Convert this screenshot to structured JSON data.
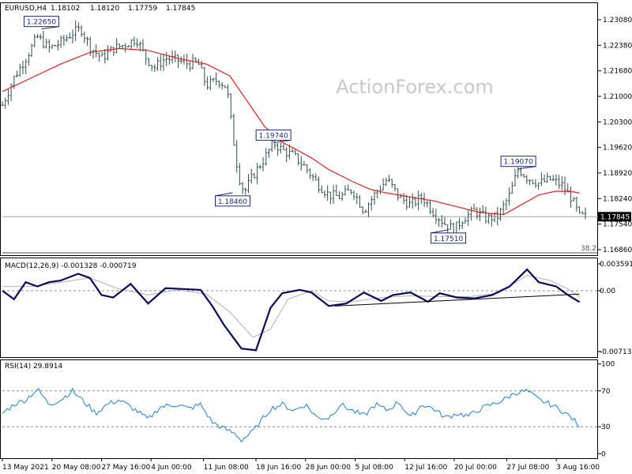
{
  "header": {
    "symbol": "EURUSD,H4",
    "ohlc": [
      "1.18102",
      "1.18120",
      "1.17759",
      "1.17845"
    ]
  },
  "watermark": "ActionForex.com",
  "colors": {
    "candle": "#2f4f4f",
    "ma": "#e02020",
    "macd": "#0a0a5a",
    "signal": "#b0b0b0",
    "rsi": "#1e7fd0",
    "price_line": "#a0a0a0",
    "trend": "#000000"
  },
  "chart_data": [
    {
      "type": "candlestick",
      "name": "price",
      "title": "EURUSD,H4 1.18102 1.18120 1.17759 1.17845",
      "ylim": [
        1.1686,
        1.2333
      ],
      "yticks": [
        "1.23080",
        "1.22380",
        "1.21680",
        "1.21000",
        "1.20300",
        "1.19620",
        "1.18920",
        "1.18240",
        "1.17540",
        "1.16860"
      ],
      "current_price": "1.17845",
      "fib_label": "38.2",
      "fib_level": 1.1692,
      "annotations": [
        {
          "label": "1.22650",
          "t": 0.067,
          "value": 1.2265
        },
        {
          "label": "1.18460",
          "t": 0.395,
          "value": 1.1846
        },
        {
          "label": "1.19740",
          "t": 0.465,
          "value": 1.1974
        },
        {
          "label": "1.17510",
          "t": 0.765,
          "value": 1.1751
        },
        {
          "label": "1.19070",
          "t": 0.885,
          "value": 1.1907
        }
      ],
      "path_points": [
        [
          0,
          1.207
        ],
        [
          0.02,
          1.214
        ],
        [
          0.04,
          1.219
        ],
        [
          0.06,
          1.2245
        ],
        [
          0.08,
          1.2215
        ],
        [
          0.1,
          1.223
        ],
        [
          0.12,
          1.2255
        ],
        [
          0.135,
          1.2265
        ],
        [
          0.15,
          1.222
        ],
        [
          0.17,
          1.219
        ],
        [
          0.19,
          1.2215
        ],
        [
          0.21,
          1.2225
        ],
        [
          0.23,
          1.224
        ],
        [
          0.245,
          1.2195
        ],
        [
          0.26,
          1.2165
        ],
        [
          0.28,
          1.219
        ],
        [
          0.3,
          1.2185
        ],
        [
          0.32,
          1.2175
        ],
        [
          0.335,
          1.218
        ],
        [
          0.35,
          1.212
        ],
        [
          0.37,
          1.2135
        ],
        [
          0.385,
          1.2115
        ],
        [
          0.395,
          1.1995
        ],
        [
          0.405,
          1.189
        ],
        [
          0.415,
          1.1846
        ],
        [
          0.43,
          1.189
        ],
        [
          0.45,
          1.1935
        ],
        [
          0.465,
          1.1974
        ],
        [
          0.48,
          1.1955
        ],
        [
          0.5,
          1.194
        ],
        [
          0.52,
          1.191
        ],
        [
          0.54,
          1.187
        ],
        [
          0.56,
          1.184
        ],
        [
          0.58,
          1.1835
        ],
        [
          0.6,
          1.1855
        ],
        [
          0.62,
          1.18
        ],
        [
          0.64,
          1.1845
        ],
        [
          0.66,
          1.188
        ],
        [
          0.68,
          1.1835
        ],
        [
          0.7,
          1.1815
        ],
        [
          0.72,
          1.1835
        ],
        [
          0.74,
          1.1795
        ],
        [
          0.76,
          1.1765
        ],
        [
          0.775,
          1.1751
        ],
        [
          0.79,
          1.178
        ],
        [
          0.81,
          1.18
        ],
        [
          0.83,
          1.178
        ],
        [
          0.85,
          1.1785
        ],
        [
          0.87,
          1.184
        ],
        [
          0.885,
          1.1907
        ],
        [
          0.9,
          1.1885
        ],
        [
          0.92,
          1.187
        ],
        [
          0.94,
          1.188
        ],
        [
          0.96,
          1.1865
        ],
        [
          0.975,
          1.1835
        ],
        [
          0.99,
          1.1785
        ]
      ],
      "ma_points": [
        [
          0,
          1.2105
        ],
        [
          0.05,
          1.214
        ],
        [
          0.1,
          1.2175
        ],
        [
          0.15,
          1.2205
        ],
        [
          0.2,
          1.2215
        ],
        [
          0.25,
          1.221
        ],
        [
          0.3,
          1.219
        ],
        [
          0.35,
          1.2175
        ],
        [
          0.39,
          1.2145
        ],
        [
          0.42,
          1.208
        ],
        [
          0.45,
          1.2015
        ],
        [
          0.48,
          1.1975
        ],
        [
          0.5,
          1.196
        ],
        [
          0.53,
          1.1935
        ],
        [
          0.56,
          1.1905
        ],
        [
          0.6,
          1.1875
        ],
        [
          0.63,
          1.1855
        ],
        [
          0.66,
          1.1845
        ],
        [
          0.7,
          1.1835
        ],
        [
          0.74,
          1.1825
        ],
        [
          0.78,
          1.181
        ],
        [
          0.82,
          1.1795
        ],
        [
          0.86,
          1.179
        ],
        [
          0.89,
          1.1815
        ],
        [
          0.92,
          1.184
        ],
        [
          0.95,
          1.185
        ],
        [
          0.98,
          1.1848
        ],
        [
          0.99,
          1.1845
        ]
      ]
    },
    {
      "type": "line",
      "name": "macd",
      "title": "MACD(12,26,9) -0.001328 -0.000719",
      "ylim": [
        -0.0078,
        0.0039
      ],
      "yticks": [
        {
          "label": "0.003591",
          "value": 0.003591
        },
        {
          "label": "0.00",
          "value": 0
        },
        {
          "label": "-0.007137",
          "value": -0.007137
        }
      ],
      "macd_points": [
        [
          0,
          0
        ],
        [
          0.02,
          -0.001
        ],
        [
          0.04,
          0.001
        ],
        [
          0.06,
          0.0005
        ],
        [
          0.08,
          0.001
        ],
        [
          0.1,
          0.0012
        ],
        [
          0.13,
          0.002
        ],
        [
          0.15,
          0.0015
        ],
        [
          0.17,
          -0.0005
        ],
        [
          0.19,
          -0.0008
        ],
        [
          0.22,
          0.0008
        ],
        [
          0.25,
          -0.0015
        ],
        [
          0.28,
          0.0003
        ],
        [
          0.31,
          0.0002
        ],
        [
          0.34,
          0.0001
        ],
        [
          0.36,
          -0.0018
        ],
        [
          0.38,
          -0.004
        ],
        [
          0.41,
          -0.0068
        ],
        [
          0.435,
          -0.007
        ],
        [
          0.46,
          -0.002
        ],
        [
          0.48,
          -0.0003
        ],
        [
          0.51,
          0.0001
        ],
        [
          0.53,
          -0.0002
        ],
        [
          0.56,
          -0.0018
        ],
        [
          0.59,
          -0.0015
        ],
        [
          0.62,
          -0.0002
        ],
        [
          0.65,
          -0.0012
        ],
        [
          0.67,
          -0.0005
        ],
        [
          0.7,
          -0.0002
        ],
        [
          0.73,
          -0.0013
        ],
        [
          0.75,
          -0.0003
        ],
        [
          0.78,
          -0.0008
        ],
        [
          0.81,
          -0.0009
        ],
        [
          0.84,
          -0.0005
        ],
        [
          0.87,
          0.0005
        ],
        [
          0.9,
          0.0025
        ],
        [
          0.92,
          0.001
        ],
        [
          0.95,
          0.0005
        ],
        [
          0.97,
          -0.0005
        ],
        [
          0.99,
          -0.001328
        ]
      ],
      "signal_points": [
        [
          0,
          0.0005
        ],
        [
          0.05,
          0.0005
        ],
        [
          0.1,
          0.001
        ],
        [
          0.15,
          0.0015
        ],
        [
          0.2,
          0.0002
        ],
        [
          0.25,
          -0.0005
        ],
        [
          0.3,
          0.0001
        ],
        [
          0.35,
          -0.0004
        ],
        [
          0.39,
          -0.0025
        ],
        [
          0.43,
          -0.0055
        ],
        [
          0.46,
          -0.0045
        ],
        [
          0.49,
          -0.001
        ],
        [
          0.53,
          0.0
        ],
        [
          0.56,
          -0.0012
        ],
        [
          0.6,
          -0.0013
        ],
        [
          0.65,
          -0.0008
        ],
        [
          0.7,
          -0.0006
        ],
        [
          0.75,
          -0.0007
        ],
        [
          0.8,
          -0.0007
        ],
        [
          0.85,
          -0.0003
        ],
        [
          0.9,
          0.0018
        ],
        [
          0.94,
          0.0012
        ],
        [
          0.97,
          0.0002
        ],
        [
          0.99,
          -0.000719
        ]
      ],
      "trendline": [
        [
          0.57,
          -0.0018
        ],
        [
          0.99,
          -0.0004
        ]
      ]
    },
    {
      "type": "line",
      "name": "rsi",
      "title": "RSI(14) 29.8914",
      "ylim": [
        -5,
        105
      ],
      "yticks": [
        {
          "label": "100",
          "value": 100
        },
        {
          "label": "70",
          "value": 70
        },
        {
          "label": "30",
          "value": 30
        },
        {
          "label": "0",
          "value": 0
        }
      ],
      "levels": [
        70,
        30
      ],
      "points": [
        [
          0,
          45
        ],
        [
          0.02,
          55
        ],
        [
          0.04,
          60
        ],
        [
          0.06,
          72
        ],
        [
          0.08,
          55
        ],
        [
          0.1,
          60
        ],
        [
          0.12,
          70
        ],
        [
          0.14,
          58
        ],
        [
          0.16,
          45
        ],
        [
          0.18,
          55
        ],
        [
          0.2,
          60
        ],
        [
          0.23,
          48
        ],
        [
          0.25,
          38
        ],
        [
          0.27,
          52
        ],
        [
          0.3,
          55
        ],
        [
          0.32,
          50
        ],
        [
          0.34,
          55
        ],
        [
          0.36,
          35
        ],
        [
          0.38,
          28
        ],
        [
          0.4,
          22
        ],
        [
          0.41,
          15
        ],
        [
          0.43,
          25
        ],
        [
          0.46,
          50
        ],
        [
          0.48,
          55
        ],
        [
          0.5,
          48
        ],
        [
          0.52,
          55
        ],
        [
          0.54,
          40
        ],
        [
          0.56,
          40
        ],
        [
          0.58,
          55
        ],
        [
          0.6,
          48
        ],
        [
          0.62,
          42
        ],
        [
          0.64,
          55
        ],
        [
          0.66,
          48
        ],
        [
          0.68,
          58
        ],
        [
          0.7,
          40
        ],
        [
          0.72,
          55
        ],
        [
          0.74,
          50
        ],
        [
          0.76,
          40
        ],
        [
          0.78,
          45
        ],
        [
          0.8,
          42
        ],
        [
          0.82,
          50
        ],
        [
          0.84,
          55
        ],
        [
          0.86,
          60
        ],
        [
          0.88,
          68
        ],
        [
          0.9,
          70
        ],
        [
          0.92,
          60
        ],
        [
          0.94,
          55
        ],
        [
          0.96,
          48
        ],
        [
          0.98,
          38
        ],
        [
          0.99,
          29.8914
        ]
      ]
    }
  ],
  "xaxis": {
    "ticks": [
      {
        "label": "13 May 2021",
        "t": 0.0
      },
      {
        "label": "20 May 08:00",
        "t": 0.085
      },
      {
        "label": "27 May 16:00",
        "t": 0.17
      },
      {
        "label": "4 Jun 00:00",
        "t": 0.255
      },
      {
        "label": "11 Jun 08:00",
        "t": 0.345
      },
      {
        "label": "18 Jun 16:00",
        "t": 0.435
      },
      {
        "label": "28 Jun 00:00",
        "t": 0.52
      },
      {
        "label": "5 Jul 08:00",
        "t": 0.605
      },
      {
        "label": "12 Jul 16:00",
        "t": 0.69
      },
      {
        "label": "20 Jul 00:00",
        "t": 0.775
      },
      {
        "label": "27 Jul 08:00",
        "t": 0.865
      },
      {
        "label": "3 Aug 16:00",
        "t": 0.95
      }
    ]
  }
}
